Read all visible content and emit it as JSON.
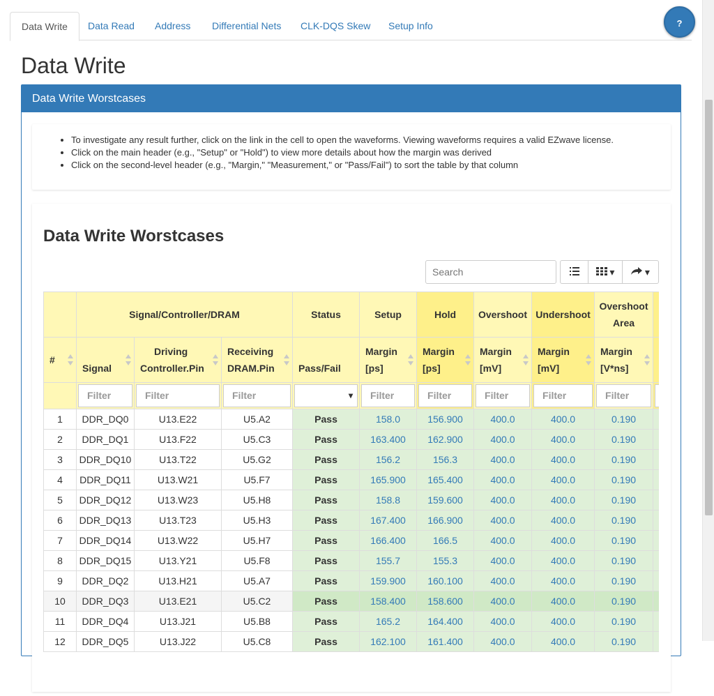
{
  "tabs": [
    "Data Write",
    "Data Read",
    "Address",
    "Differential Nets",
    "CLK-DQS Skew",
    "Setup Info"
  ],
  "help_label": "?",
  "page_title": "Data Write",
  "panel_heading": "Data Write Worstcases",
  "info_items": [
    "To investigate any result further, click on the link in the cell to open the waveforms. Viewing waveforms requires a valid EZwave license.",
    "Click on the main header (e.g., \"Setup\" or \"Hold\") to view more details about how the margin was derived",
    "Click on the second-level header (e.g., \"Margin,\" \"Measurement,\" or \"Pass/Fail\") to sort the table by that column"
  ],
  "card_title": "Data Write Worstcases",
  "search_placeholder": "Search",
  "table": {
    "group_headers": {
      "signal": "Signal/Controller/DRAM",
      "status": "Status",
      "setup": "Setup",
      "hold": "Hold",
      "overshoot": "Overshoot",
      "undershoot": "Undershoot",
      "overshoot_area_1": "Overshoot",
      "overshoot_area_2": "Area"
    },
    "columns": {
      "hash": "#",
      "signal": "Signal",
      "driving_1": "Driving",
      "driving_2": "Controller.Pin",
      "receiving_1": "Receiving",
      "receiving_2": "DRAM.Pin",
      "passfail": "Pass/Fail",
      "setup_1": "Margin",
      "setup_2": "[ps]",
      "hold_1": "Margin",
      "hold_2": "[ps]",
      "over_1": "Margin",
      "over_2": "[mV]",
      "under_1": "Margin",
      "under_2": "[mV]",
      "area_1": "Margin",
      "area_2": "[V*ns]"
    },
    "filter_placeholder": "Filter",
    "rows": [
      [
        "1",
        "DDR_DQ0",
        "U13.E22",
        "U5.A2",
        "Pass",
        "158.0",
        "156.900",
        "400.0",
        "400.0",
        "0.190"
      ],
      [
        "2",
        "DDR_DQ1",
        "U13.F22",
        "U5.C3",
        "Pass",
        "163.400",
        "162.900",
        "400.0",
        "400.0",
        "0.190"
      ],
      [
        "3",
        "DDR_DQ10",
        "U13.T22",
        "U5.G2",
        "Pass",
        "156.2",
        "156.3",
        "400.0",
        "400.0",
        "0.190"
      ],
      [
        "4",
        "DDR_DQ11",
        "U13.W21",
        "U5.F7",
        "Pass",
        "165.900",
        "165.400",
        "400.0",
        "400.0",
        "0.190"
      ],
      [
        "5",
        "DDR_DQ12",
        "U13.W23",
        "U5.H8",
        "Pass",
        "158.8",
        "159.600",
        "400.0",
        "400.0",
        "0.190"
      ],
      [
        "6",
        "DDR_DQ13",
        "U13.T23",
        "U5.H3",
        "Pass",
        "167.400",
        "166.900",
        "400.0",
        "400.0",
        "0.190"
      ],
      [
        "7",
        "DDR_DQ14",
        "U13.W22",
        "U5.H7",
        "Pass",
        "166.400",
        "166.5",
        "400.0",
        "400.0",
        "0.190"
      ],
      [
        "8",
        "DDR_DQ15",
        "U13.Y21",
        "U5.F8",
        "Pass",
        "155.7",
        "155.3",
        "400.0",
        "400.0",
        "0.190"
      ],
      [
        "9",
        "DDR_DQ2",
        "U13.H21",
        "U5.A7",
        "Pass",
        "159.900",
        "160.100",
        "400.0",
        "400.0",
        "0.190"
      ],
      [
        "10",
        "DDR_DQ3",
        "U13.E21",
        "U5.C2",
        "Pass",
        "158.400",
        "158.600",
        "400.0",
        "400.0",
        "0.190"
      ],
      [
        "11",
        "DDR_DQ4",
        "U13.J21",
        "U5.B8",
        "Pass",
        "165.2",
        "164.400",
        "400.0",
        "400.0",
        "0.190"
      ],
      [
        "12",
        "DDR_DQ5",
        "U13.J22",
        "U5.C8",
        "Pass",
        "162.100",
        "161.400",
        "400.0",
        "400.0",
        "0.190"
      ]
    ],
    "highlighted_row": 10
  }
}
